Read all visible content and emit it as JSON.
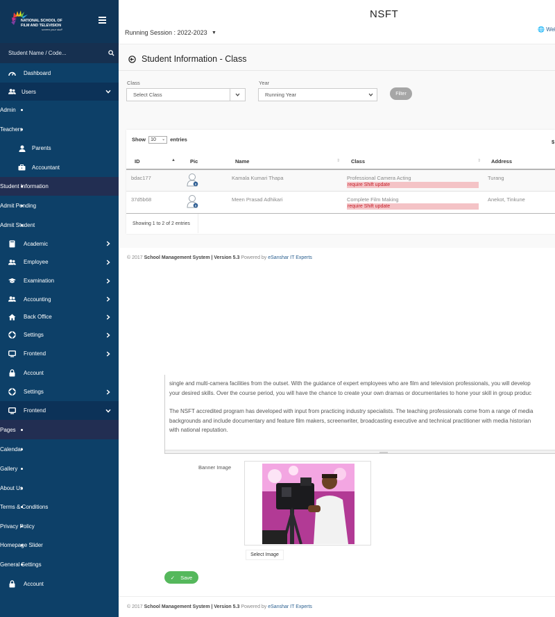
{
  "brand": {
    "logo_text": "NATIONAL SCHOOL OF FILM AND TELEVISION",
    "logo_tagline": "screen your stuff",
    "app_title": "NSFT"
  },
  "sidebar": {
    "search_placeholder": "Student Name / Code...",
    "items": [
      {
        "label": "Dashboard",
        "icon": "gauge-icon"
      },
      {
        "label": "Users",
        "icon": "users-icon"
      },
      {
        "label": "Admin"
      },
      {
        "label": "Teachers"
      },
      {
        "label": "Parents",
        "icon": "user-icon"
      },
      {
        "label": "Accountant",
        "icon": "briefcase-icon"
      },
      {
        "label": "Student Information"
      },
      {
        "label": "Admit Pending"
      },
      {
        "label": "Admit Student"
      },
      {
        "label": "Academic",
        "icon": "book-icon"
      },
      {
        "label": "Employee",
        "icon": "employees-icon"
      },
      {
        "label": "Examination",
        "icon": "graduation-cap-icon"
      },
      {
        "label": "Accounting",
        "icon": "users-icon"
      },
      {
        "label": "Back Office",
        "icon": "home-icon"
      },
      {
        "label": "Settings",
        "icon": "life-ring-icon"
      },
      {
        "label": "Frontend",
        "icon": "monitor-icon"
      },
      {
        "label": "Account",
        "icon": "lock-icon"
      },
      {
        "label": "Settings",
        "icon": "life-ring-icon"
      },
      {
        "label": "Frontend",
        "icon": "monitor-icon"
      },
      {
        "label": "Pages"
      },
      {
        "label": "Calendar"
      },
      {
        "label": "Gallery"
      },
      {
        "label": "About Us"
      },
      {
        "label": "Terms & Conditions"
      },
      {
        "label": "Privacy Policy"
      },
      {
        "label": "Homepage Slider"
      },
      {
        "label": "General Settings"
      },
      {
        "label": "Account",
        "icon": "lock-icon"
      }
    ]
  },
  "header": {
    "session": "Running Session : 2022-2023",
    "web_link": "Web"
  },
  "page": {
    "title": "Student Information - Class"
  },
  "filters": {
    "class_label": "Class",
    "class_value": "Select Class",
    "year_label": "Year",
    "year_value": "Running Year",
    "filter_button": "Filter"
  },
  "table": {
    "show_label": "Show",
    "entries_value": "10",
    "entries_label": "entries",
    "currency_symbol": "$",
    "columns": [
      "ID",
      "Pic",
      "Name",
      "Class",
      "Address"
    ],
    "rows": [
      {
        "id": "bdac177",
        "name": "Kamala Kumari Thapa",
        "class": "Professional Camera Acting",
        "badge": "require Shift update",
        "address": "Turang"
      },
      {
        "id": "37d5b68",
        "name": "Meen Prasad Adhikari",
        "class": "Complete Film Making",
        "badge": "require Shift update",
        "address": "Anekot, Tinkune"
      }
    ],
    "info": "Showing 1 to 2 of 2 entries"
  },
  "footer": {
    "copyright": "© 2017",
    "system": "School Management System | Version 5.3",
    "powered": "Powered by",
    "company": "eSanshar IT Experts"
  },
  "editor": {
    "line1": "single and multi-camera facilities from the outset. With the guidance of expert employees who are film and television professionals, you will develop",
    "line2": "your desired skills. Over the course period, you will have the chance to create your own dramas or documentaries to hone your skill in group produc",
    "line3": "The NSFT accredited program has developed with input from practicing industry specialists. The teaching professionals come from a range of media",
    "line4": "backgrounds and include documentary and feature film makers, screenwriter, broadcasting executive and technical practitioner with media historian",
    "line5": "with national reputation."
  },
  "banner": {
    "label": "Banner Image",
    "select_button": "Select Image"
  },
  "save_button": "Save",
  "colors": {
    "sidebar": "#0d4068",
    "sidebar_active": "#222e52",
    "badge_bg": "#f4c3c6",
    "badge_text": "#c51f2a",
    "save": "#55b85c",
    "filter": "#a6a6a6"
  }
}
